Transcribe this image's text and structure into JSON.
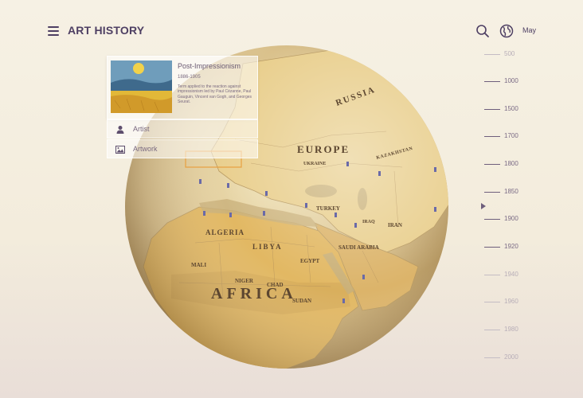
{
  "header": {
    "title": "ART HISTORY",
    "language": "May"
  },
  "card": {
    "title": "Post-Impressionism",
    "years": "1886-1905",
    "description": "Term applied to the reaction against impressionism led by Paul Cézanne, Paul Gauguin, Vincent van Gogh, and Georges Seurat."
  },
  "sub_items": [
    {
      "label": "Artist",
      "icon": "person-icon"
    },
    {
      "label": "Artwork",
      "icon": "image-icon"
    }
  ],
  "map": {
    "labels": [
      "RUSSIA",
      "EUROPE",
      "KAZAKHSTAN",
      "UKRAINE",
      "TURKEY",
      "IRAN",
      "IRAQ",
      "ALGERIA",
      "LIBYA",
      "EGYPT",
      "SAUDI ARABIA",
      "MALI",
      "NIGER",
      "CHAD",
      "SUDAN",
      "AFRICA"
    ]
  },
  "timeline": {
    "years": [
      "500",
      "1000",
      "1500",
      "1700",
      "1800",
      "1850",
      "1900",
      "1920",
      "1940",
      "1960",
      "1980",
      "2000"
    ],
    "selected": "1900"
  },
  "colors": {
    "accent": "#4e3f63",
    "highlight": "#e8a040"
  }
}
